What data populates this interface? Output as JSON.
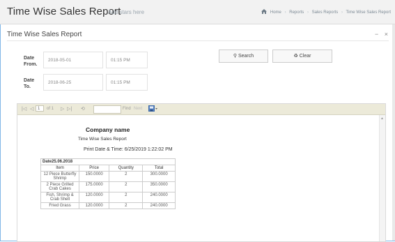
{
  "header": {
    "app_title": "Time Wise Sales Report",
    "app_subtitle": "Add stars here",
    "breadcrumb": [
      "Home",
      "Reports",
      "Sales Reports",
      "Time Wise Sales Report"
    ]
  },
  "portlet": {
    "title": "Time Wise Sales Report",
    "tools": [
      "−",
      "×"
    ]
  },
  "filters": {
    "date_from_label": "Date From.",
    "date_from_value": "2018-05-01",
    "time_from_value": "01:15 PM",
    "date_to_label": "Date To.",
    "date_to_value": "2018-06-25",
    "time_to_value": "01:15 PM",
    "search_label": "Search",
    "clear_label": "Clear"
  },
  "toolbar": {
    "first": "|◁",
    "prev": "◁",
    "page": "1",
    "of": "of 1",
    "next": "▷",
    "last": "▷|",
    "refresh": "⟲",
    "find": "Find",
    "next_find": "Next"
  },
  "report": {
    "company": "Company name",
    "title": "Time Wise Sales Report",
    "print_date": "Print Date & Time: 6/25/2019 1:22:02 PM",
    "date_row": "Date25.06.2018",
    "columns": [
      "Item",
      "Price",
      "Quantity",
      "Total"
    ],
    "rows": [
      [
        "12 Piece Butterfly Shrimp",
        "150.0000",
        "2",
        "300.0000"
      ],
      [
        "2 Piece Grilled Crab Cakes",
        "175.0000",
        "2",
        "350.0000"
      ],
      [
        "Fish, Shrimp & Crab Shell",
        "120.0000",
        "2",
        "240.0000"
      ],
      [
        "Fried Grass",
        "120.0000",
        "2",
        "240.0000"
      ]
    ]
  },
  "colors": {
    "border_accent": "#7fb6e6",
    "toolbar_bg": "#ecead9"
  }
}
